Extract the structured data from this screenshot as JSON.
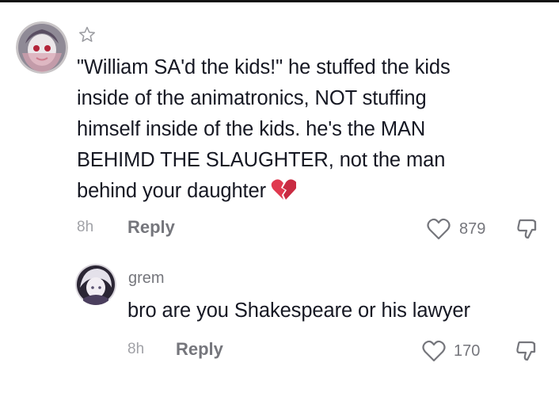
{
  "colors": {
    "text": "#161823",
    "muted": "#75767c",
    "time": "#a1a2a7",
    "broken_heart": "#e0394f"
  },
  "comments": [
    {
      "username": "",
      "lines": [
        "\"William SA'd the kids!\" he stuffed the kids",
        "inside of the animatronics, NOT stuffing",
        "himself inside of the kids. he's the MAN",
        "BEHIMD THE SLAUGHTER, not the man",
        "behind your daughter"
      ],
      "emoji": "broken-heart",
      "time": "8h",
      "reply_label": "Reply",
      "likes": "879"
    },
    {
      "username": "grem",
      "lines": [
        "bro are you Shakespeare or his lawyer"
      ],
      "time": "8h",
      "reply_label": "Reply",
      "likes": "170"
    }
  ],
  "icons": {
    "star": "star-outline-icon",
    "like": "heart-outline-icon",
    "dislike": "thumbs-down-icon"
  }
}
